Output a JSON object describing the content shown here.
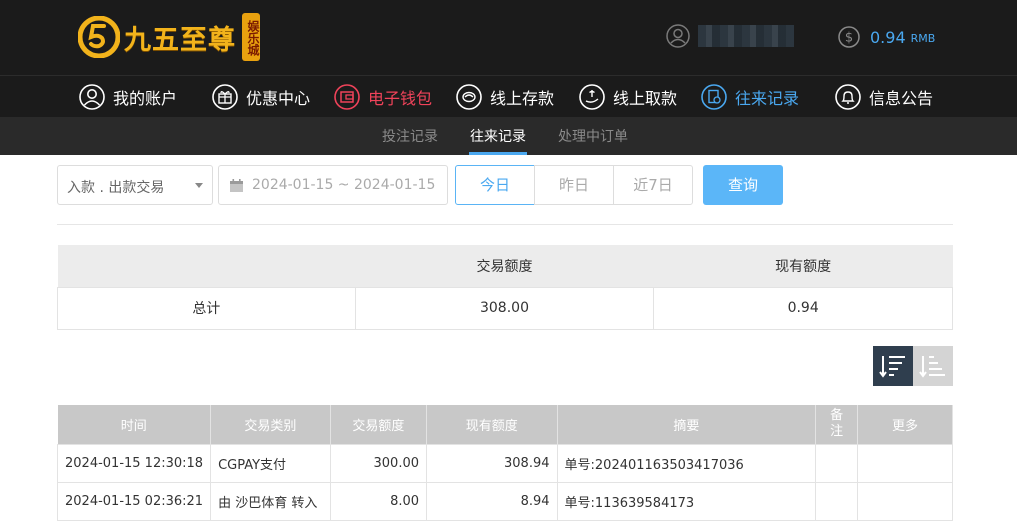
{
  "header": {
    "logo_text": "九五至尊",
    "logo_badge": "娱乐城",
    "balance_value": "0.94",
    "balance_unit": "RMB"
  },
  "nav": [
    {
      "label": "我的账户",
      "icon": "user-icon"
    },
    {
      "label": "优惠中心",
      "icon": "gift-icon"
    },
    {
      "label": "电子钱包",
      "icon": "wallet-icon",
      "color": "#f0435a"
    },
    {
      "label": "线上存款",
      "icon": "deposit-icon"
    },
    {
      "label": "线上取款",
      "icon": "withdraw-icon"
    },
    {
      "label": "往来记录",
      "icon": "records-icon",
      "color": "#4aa8f0"
    },
    {
      "label": "信息公告",
      "icon": "bell-icon"
    }
  ],
  "subnav": [
    {
      "label": "投注记录"
    },
    {
      "label": "往来记录",
      "active": true
    },
    {
      "label": "处理中订单"
    }
  ],
  "filter": {
    "type_select": "入款 . 出款交易",
    "date_range": "2024-01-15 ~ 2024-01-15",
    "quick": [
      "今日",
      "昨日",
      "近7日"
    ],
    "query_label": "查询"
  },
  "summary": {
    "headers": [
      "",
      "交易额度",
      "现有额度"
    ],
    "row": [
      "总计",
      "308.00",
      "0.94"
    ]
  },
  "records": {
    "headers": [
      "时间",
      "交易类别",
      "交易额度",
      "现有额度",
      "摘要",
      "备注",
      "更多"
    ],
    "rows": [
      [
        "2024-01-15 12:30:18",
        "CGPAY支付",
        "300.00",
        "308.94",
        "单号:202401163503417036",
        "",
        ""
      ],
      [
        "2024-01-15 02:36:21",
        "由 沙巴体育 转入",
        "8.00",
        "8.94",
        "单号:113639584173",
        "",
        ""
      ]
    ]
  },
  "colors": {
    "bar_bg": "#1b1b1b",
    "accent_blue": "#4aa8f0",
    "accent_red": "#f0435a",
    "logo_gold": "#f2b31b"
  }
}
